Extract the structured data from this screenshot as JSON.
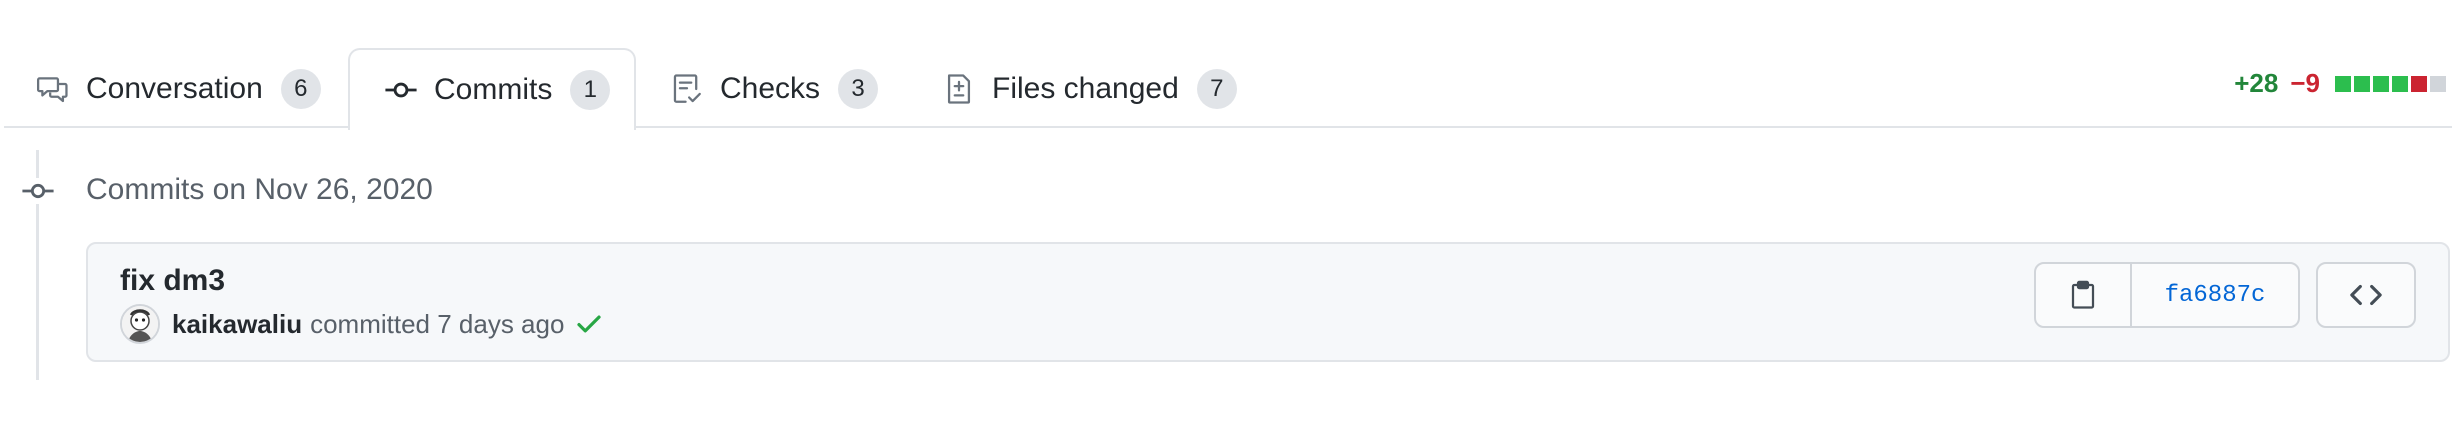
{
  "tabs": [
    {
      "label": "Conversation",
      "count": "6",
      "icon": "comment-discussion-icon"
    },
    {
      "label": "Commits",
      "count": "1",
      "icon": "git-commit-icon",
      "selected": true
    },
    {
      "label": "Checks",
      "count": "3",
      "icon": "checklist-icon"
    },
    {
      "label": "Files changed",
      "count": "7",
      "icon": "file-diff-icon"
    }
  ],
  "diffstat": {
    "additions": "+28",
    "deletions": "−9",
    "blocks": [
      "added",
      "added",
      "added",
      "added",
      "deleted",
      "neutral"
    ],
    "colors": {
      "added": "#2cbe4e",
      "deleted": "#cb2431",
      "neutral": "#d1d5da"
    }
  },
  "timeline": {
    "day_header": "Commits on Nov 26, 2020"
  },
  "commit": {
    "title": "fix dm3",
    "author": "kaikawaliu",
    "action": "committed",
    "time": "7 days ago",
    "status_icon": "check-icon",
    "status_color": "#28a745",
    "sha": "fa6887c",
    "copy_icon": "clippy-icon",
    "browse_icon": "code-icon"
  },
  "colors": {
    "text": "#24292e",
    "muted": "#586069",
    "link": "#0366d6",
    "border": "#e1e4e8",
    "box_bg": "#f6f8fa"
  }
}
